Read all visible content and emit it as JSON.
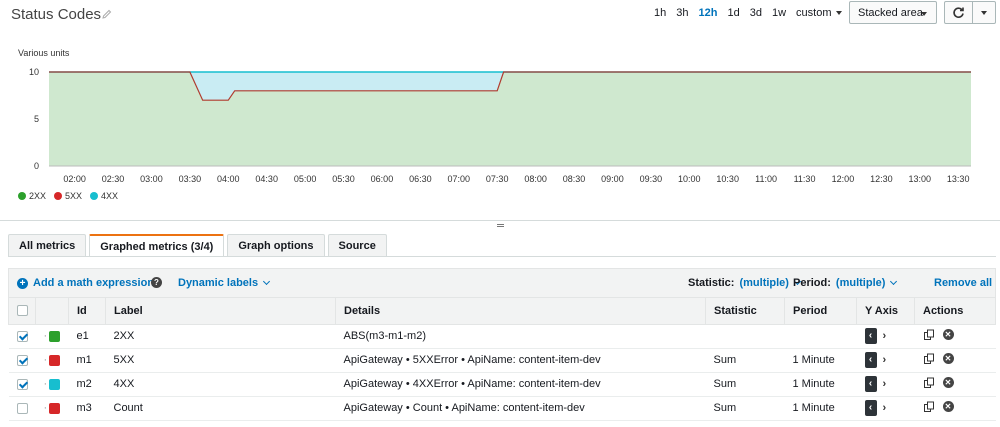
{
  "header": {
    "title": "Status Codes",
    "time_ranges": [
      "1h",
      "3h",
      "12h",
      "1d",
      "3d",
      "1w"
    ],
    "active_range": "12h",
    "custom_label": "custom",
    "chart_type_label": "Stacked area"
  },
  "chart_data": {
    "type": "area",
    "units_label": "Various units",
    "yticks": [
      0,
      5,
      10
    ],
    "ylim": [
      0,
      10
    ],
    "x_ticks": [
      "02:00",
      "02:30",
      "03:00",
      "03:30",
      "04:00",
      "04:30",
      "05:00",
      "05:30",
      "06:00",
      "06:30",
      "07:00",
      "07:30",
      "08:00",
      "08:30",
      "09:00",
      "09:30",
      "10:00",
      "10:30",
      "11:00",
      "11:30",
      "12:00",
      "12:30",
      "13:00",
      "13:30"
    ],
    "series": [
      {
        "name": "2XX",
        "color": "#2ca02c",
        "x": [
          "01:40",
          "03:30",
          "03:40",
          "04:00",
          "04:05",
          "07:30",
          "07:35",
          "13:40"
        ],
        "values": [
          10,
          10,
          7,
          7,
          8,
          8,
          10,
          10
        ]
      },
      {
        "name": "5XX",
        "color": "#d62728",
        "x": [
          "01:40",
          "13:40"
        ],
        "values": [
          0,
          0
        ]
      },
      {
        "name": "4XX",
        "color": "#17becf",
        "x": [
          "01:40",
          "03:30",
          "03:40",
          "04:00",
          "04:05",
          "07:30",
          "07:35",
          "13:40"
        ],
        "values": [
          0,
          0,
          3,
          3,
          2,
          2,
          0,
          0
        ]
      }
    ],
    "legend_position": "bottom-left",
    "grid": false
  },
  "tabs": [
    "All metrics",
    "Graphed metrics (3/4)",
    "Graph options",
    "Source"
  ],
  "active_tab": 1,
  "toolbar": {
    "add_math": "Add a math expression",
    "dynamic_labels": "Dynamic labels",
    "statistic_label": "Statistic:",
    "statistic_value": "(multiple)",
    "period_label": "Period:",
    "period_value": "(multiple)",
    "remove_all": "Remove all"
  },
  "table": {
    "headers": [
      "Id",
      "Label",
      "Details",
      "Statistic",
      "Period",
      "Y Axis",
      "Actions"
    ],
    "rows": [
      {
        "checked": true,
        "color": "#2ca02c",
        "id": "e1",
        "label": "2XX",
        "details": "ABS(m3-m1-m2)",
        "statistic": "",
        "period": ""
      },
      {
        "checked": true,
        "color": "#d62728",
        "id": "m1",
        "label": "5XX",
        "details": "ApiGateway • 5XXError • ApiName: content-item-dev",
        "statistic": "Sum",
        "period": "1 Minute"
      },
      {
        "checked": true,
        "color": "#17becf",
        "id": "m2",
        "label": "4XX",
        "details": "ApiGateway • 4XXError • ApiName: content-item-dev",
        "statistic": "Sum",
        "period": "1 Minute"
      },
      {
        "checked": false,
        "color": "#d62728",
        "id": "m3",
        "label": "Count",
        "details": "ApiGateway • Count • ApiName: content-item-dev",
        "statistic": "Sum",
        "period": "1 Minute"
      }
    ]
  }
}
